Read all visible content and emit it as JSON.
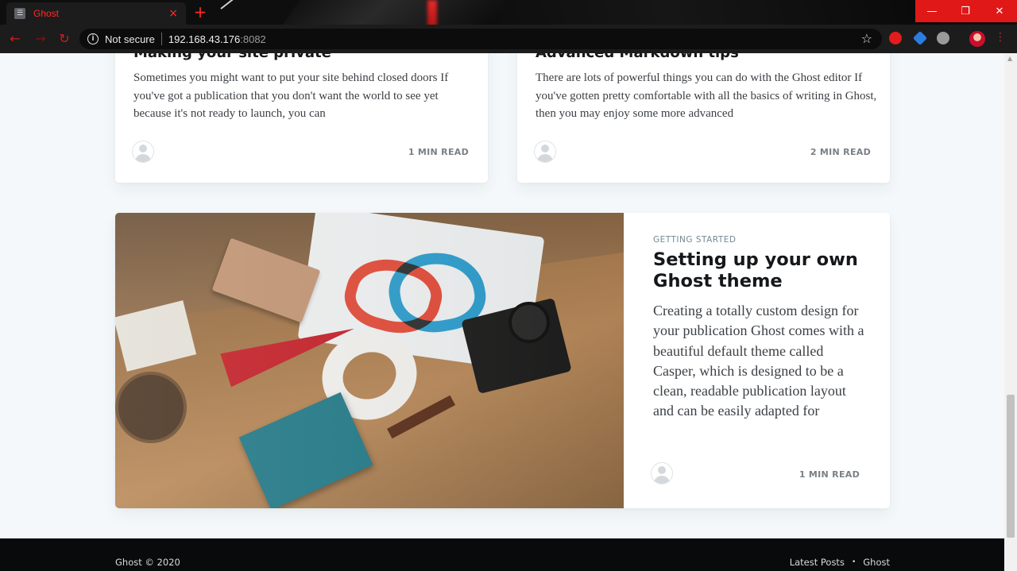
{
  "browser": {
    "tab_title": "Ghost",
    "tab_favicon_glyph": "☰",
    "tab_close_glyph": "×",
    "new_tab_glyph": "+",
    "security_label": "Not secure",
    "url_host": "192.168.43.176",
    "url_port": ":8082",
    "back_glyph": "←",
    "forward_glyph": "→",
    "reload_glyph": "↻",
    "star_glyph": "☆",
    "menu_glyph": "⋮",
    "minimize_glyph": "—",
    "maximize_glyph": "❐",
    "close_glyph": "✕",
    "accent_color": "#e01818"
  },
  "posts": [
    {
      "title": "Making your site private",
      "excerpt": "Sometimes you might want to put your site behind closed doors If you've got a publication that you don't want the world to see yet because it's not ready to launch, you can",
      "reading_time": "1 MIN READ"
    },
    {
      "title": "Advanced Markdown tips",
      "excerpt": "There are lots of powerful things you can do with the Ghost editor If you've gotten pretty comfortable with all the basics of writing in Ghost, then you may enjoy some more advanced",
      "reading_time": "2 MIN READ"
    }
  ],
  "featured_post": {
    "tag": "Getting Started",
    "title": "Setting up your own Ghost theme",
    "excerpt": "Creating a totally custom design for your publication Ghost comes with a beautiful default theme called Casper, which is designed to be a clean, readable publication layout and can be easily adapted for",
    "reading_time": "1 MIN READ",
    "image": "desk-flatlay-photo"
  },
  "footer": {
    "copyright": "Ghost © 2020",
    "links": [
      "Latest Posts",
      "Ghost"
    ],
    "separator": "•"
  }
}
